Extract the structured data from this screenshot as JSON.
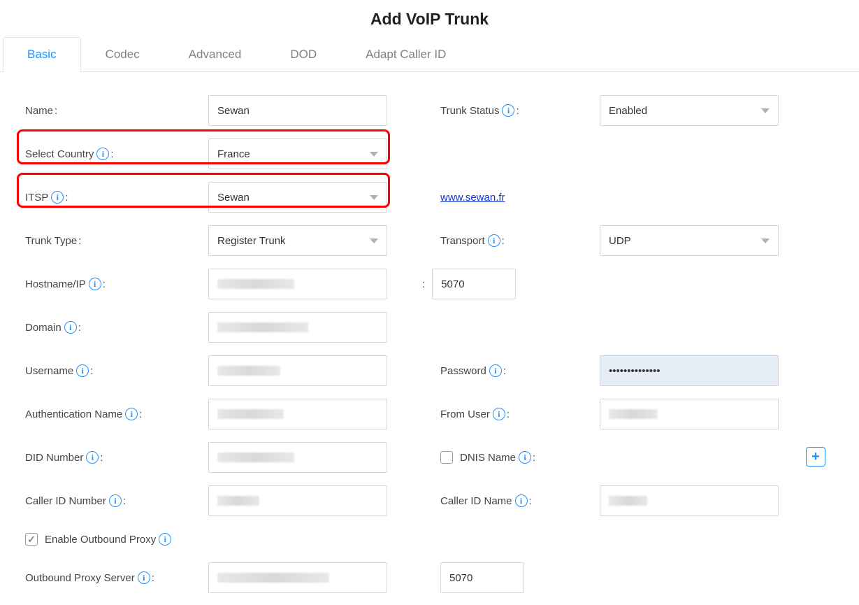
{
  "title": "Add VoIP Trunk",
  "tabs": {
    "basic": "Basic",
    "codec": "Codec",
    "advanced": "Advanced",
    "dod": "DOD",
    "adapt": "Adapt Caller ID"
  },
  "labels": {
    "name": "Name",
    "trunk_status": "Trunk Status",
    "select_country": "Select Country",
    "itsp": "ITSP",
    "trunk_type": "Trunk Type",
    "transport": "Transport",
    "hostname": "Hostname/IP",
    "domain": "Domain",
    "username": "Username",
    "password": "Password",
    "auth_name": "Authentication Name",
    "from_user": "From User",
    "did_number": "DID Number",
    "dnis_name": "DNIS Name",
    "caller_id_number": "Caller ID Number",
    "caller_id_name": "Caller ID Name",
    "enable_outbound_proxy": "Enable Outbound Proxy",
    "outbound_proxy_server": "Outbound Proxy Server"
  },
  "values": {
    "name": "Sewan",
    "trunk_status": "Enabled",
    "select_country": "France",
    "itsp": "Sewan",
    "itsp_link": "www.sewan.fr",
    "trunk_type": "Register Trunk",
    "transport": "UDP",
    "hostname_port": "5070",
    "password_masked": "••••••••••••••",
    "outbound_port": "5070"
  },
  "info_glyph": "i"
}
